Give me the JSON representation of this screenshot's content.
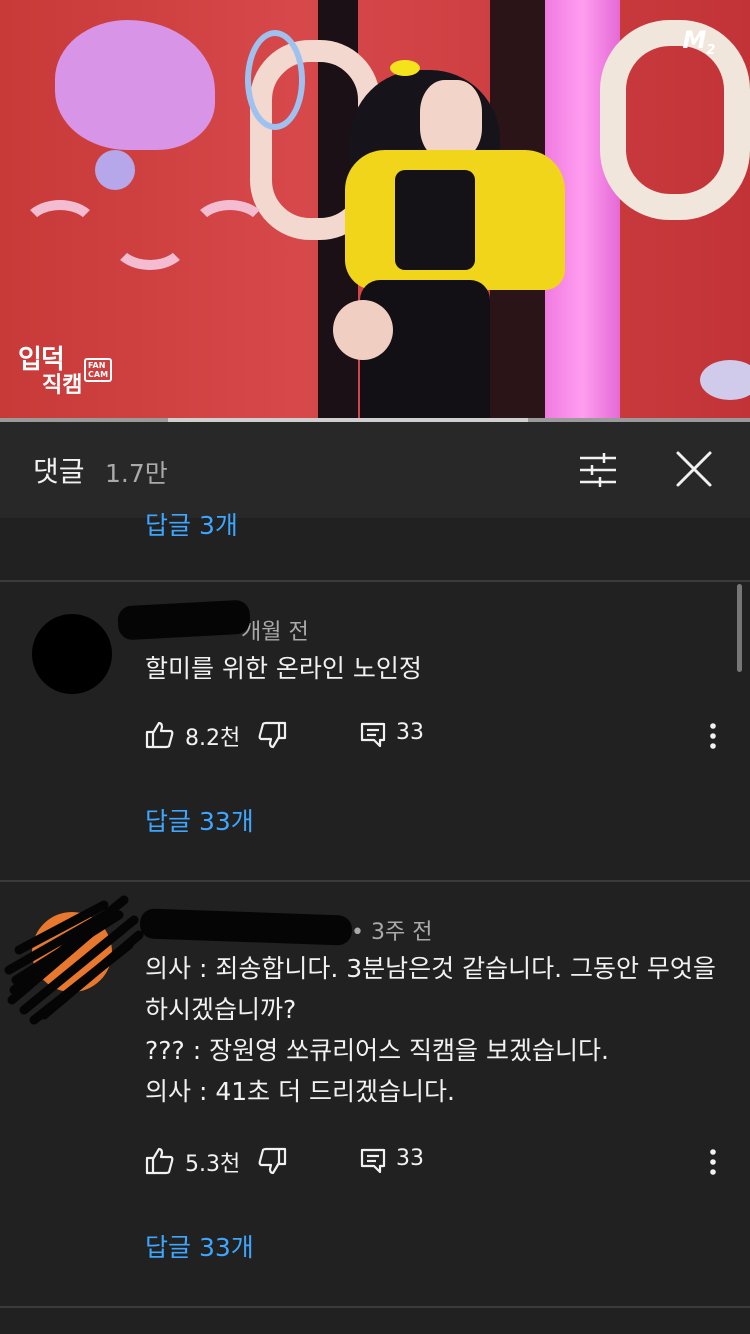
{
  "video": {
    "channel_badge": "M",
    "channel_badge_sub": "2",
    "overlay_logo_line1": "입덕",
    "overlay_logo_line2": "직캠",
    "overlay_logo_tag": "FAN CAM",
    "progress_played_fraction": 0.0,
    "progress_buffered_fraction": 0.48
  },
  "comments_header": {
    "title": "댓글",
    "count": "1.7만"
  },
  "partial_reply_link": "답글 3개",
  "comments": [
    {
      "time": "개월 전",
      "text": "할미를 위한 온라인 노인정",
      "likes": "8.2천",
      "replies": "33",
      "replies_link": "답글 33개"
    },
    {
      "time": "• 3주 전",
      "text": "의사 : 죄송합니다. 3분남은것 같습니다. 그동안 무엇을 하시겠습니까?\n??? : 장원영 쏘큐리어스 직캠을 보겠습니다.\n의사 : 41초 더 드리겠습니다.",
      "likes": "5.3천",
      "replies": "33",
      "replies_link": "답글 33개"
    }
  ]
}
